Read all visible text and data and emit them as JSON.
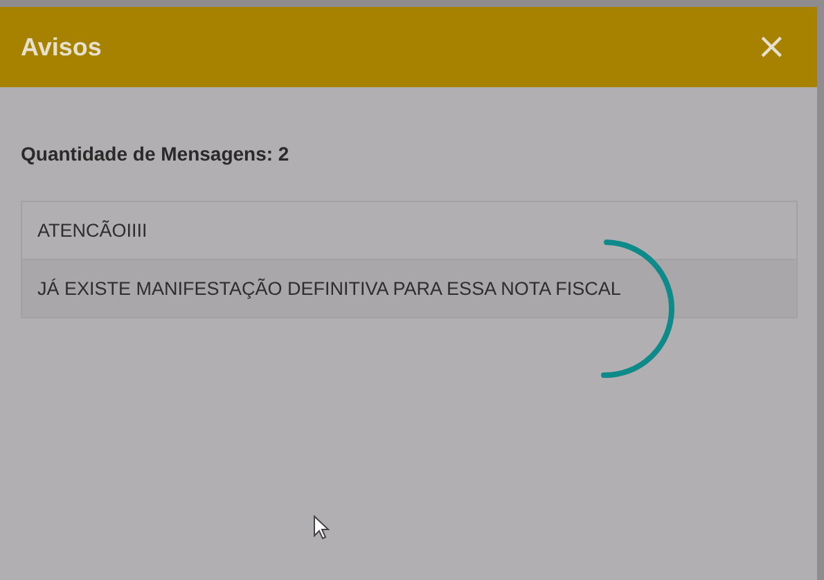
{
  "dialog": {
    "title": "Avisos",
    "close": "×"
  },
  "summary": "Quantidade de Mensagens: 2",
  "messages": [
    {
      "text": "ATENCÃOIIII"
    },
    {
      "text": "JÁ EXISTE MANIFESTAÇÃO DEFINITIVA PARA ESSA NOTA FISCAL"
    }
  ],
  "loading": true
}
